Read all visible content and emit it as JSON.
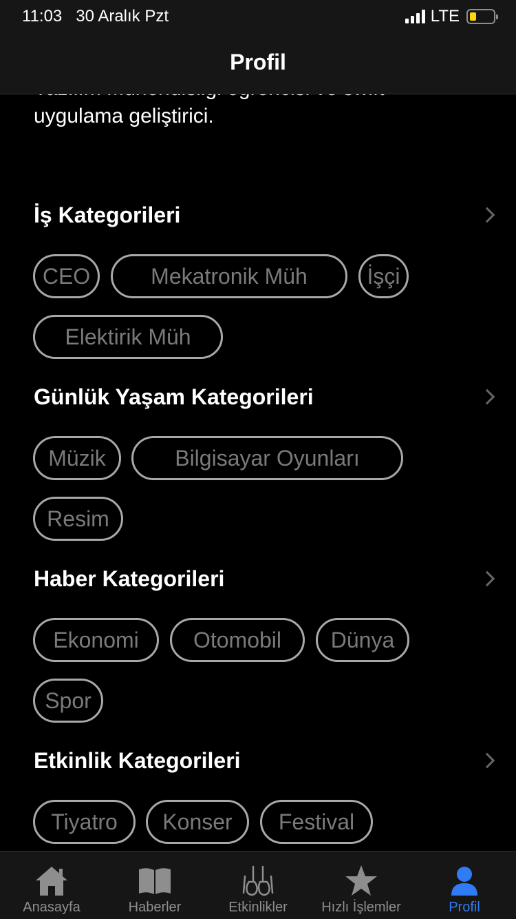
{
  "status_bar": {
    "time": "11:03",
    "date": "30 Aralık Pzt",
    "carrier": "LTE",
    "battery_level": 0.2,
    "battery_color": "#ffd60a"
  },
  "nav": {
    "title": "Profil"
  },
  "profile": {
    "bio_line1": "Yazılım Mühendisliği öğrencisi ve swift",
    "bio_line2": "uygulama geliştirici."
  },
  "sections": [
    {
      "title": "İş Kategorileri",
      "chips": [
        "CEO",
        "Mekatronik Müh",
        "İşçi",
        "Elektirik Müh"
      ]
    },
    {
      "title": "Günlük Yaşam Kategorileri",
      "chips": [
        "Müzik",
        "Bilgisayar Oyunları",
        "Resim"
      ]
    },
    {
      "title": "Haber Kategorileri",
      "chips": [
        "Ekonomi",
        "Otomobil",
        "Dünya",
        "Spor"
      ]
    },
    {
      "title": "Etkinlik Kategorileri",
      "chips": [
        "Tiyatro",
        "Konser",
        "Festival"
      ]
    }
  ],
  "tabs": [
    {
      "label": "Anasayfa",
      "icon": "house-icon"
    },
    {
      "label": "Haberler",
      "icon": "book-icon"
    },
    {
      "label": "Etkinlikler",
      "icon": "guitars-icon"
    },
    {
      "label": "Hızlı İşlemler",
      "icon": "star-icon"
    },
    {
      "label": "Profil",
      "icon": "person-icon",
      "active": true
    }
  ],
  "colors": {
    "accent": "#2f7cf6",
    "chip_border": "#a8a8a8",
    "chip_text": "#7a7a7a",
    "bar_bg": "#161616"
  }
}
